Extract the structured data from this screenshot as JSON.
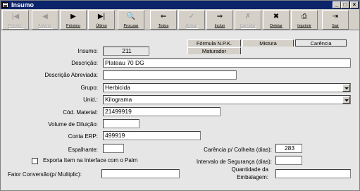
{
  "window": {
    "title": "Insumo",
    "controls": [
      "_",
      "□",
      "×"
    ]
  },
  "toolbar": {
    "buttons": [
      {
        "label": "Primeiro",
        "icon": "|◀",
        "enabled": false
      },
      {
        "label": "Anterior",
        "icon": "◀",
        "enabled": false
      },
      {
        "label": "Próximo",
        "icon": "▶",
        "enabled": true
      },
      {
        "label": "Último",
        "icon": "▶|",
        "enabled": true
      },
      {
        "label": "Procurar",
        "icon": "🔍",
        "enabled": true
      },
      {
        "label": "Todos",
        "icon": "⇐",
        "enabled": true
      },
      {
        "label": "Aplicar",
        "icon": "✓",
        "enabled": false
      },
      {
        "label": "Incluir",
        "icon": "⇒",
        "enabled": true
      },
      {
        "label": "Cancelar",
        "icon": "✗",
        "enabled": false
      },
      {
        "label": "Deletar",
        "icon": "✖",
        "enabled": true
      },
      {
        "label": "Imprimir",
        "icon": "⎙",
        "enabled": true
      },
      {
        "label": "Sair",
        "icon": "⇥",
        "enabled": true
      }
    ]
  },
  "tabs": [
    "Fórmula N.P.K.",
    "Mistura",
    "Carência",
    "Maturador"
  ],
  "form": {
    "insumo_label": "Insumo:",
    "insumo_value": "211",
    "descricao_label": "Descrição:",
    "descricao_value": "Plateau 70 DG",
    "descricao_abrev_label": "Descrição Abreviada:",
    "descricao_abrev_value": "",
    "grupo_label": "Grupo:",
    "grupo_value": "Herbicida",
    "unid_label": "Unid.:",
    "unid_value": "Kilograma",
    "cod_material_label": "Cód. Material:",
    "cod_material_value": "21499919",
    "volume_diluicao_label": "Volume de Diluição:",
    "volume_diluicao_value": "",
    "conta_erp_label": "Conta ERP:",
    "conta_erp_value": "499919",
    "espalhante_label": "Espalhante:",
    "espalhante_value": "",
    "carencia_label": "Carência p/ Colheita (dias):",
    "carencia_value": "283",
    "exporta_label": "Exporta Item na Interface com o Palm",
    "intervalo_label": "Intervalo de Segurança (dias):",
    "intervalo_value": "",
    "fator_label": "Fator Conversão(p/ Multiplic):",
    "fator_value": "",
    "quantidade_label_1": "Quantidade da",
    "quantidade_label_2": "Embalagem:",
    "quantidade_value": ""
  }
}
